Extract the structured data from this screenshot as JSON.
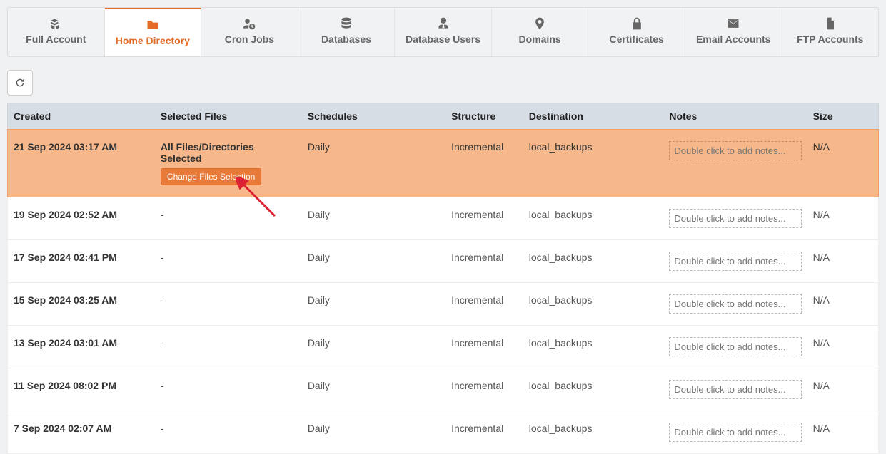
{
  "tabs": [
    {
      "label": "Full Account",
      "icon": "cubes"
    },
    {
      "label": "Home Directory",
      "icon": "folder",
      "active": true
    },
    {
      "label": "Cron Jobs",
      "icon": "user-clock"
    },
    {
      "label": "Databases",
      "icon": "database"
    },
    {
      "label": "Database Users",
      "icon": "user-tie"
    },
    {
      "label": "Domains",
      "icon": "map-pin"
    },
    {
      "label": "Certificates",
      "icon": "lock"
    },
    {
      "label": "Email Accounts",
      "icon": "envelope"
    },
    {
      "label": "FTP Accounts",
      "icon": "file"
    }
  ],
  "refresh_title": "Refresh",
  "columns": {
    "created": "Created",
    "files": "Selected Files",
    "schedules": "Schedules",
    "structure": "Structure",
    "dest": "Destination",
    "notes": "Notes",
    "size": "Size"
  },
  "notes_placeholder": "Double click to add notes...",
  "change_files_label": "Change Files Selection",
  "rows": [
    {
      "created": "21 Sep 2024 03:17 AM",
      "files": "All Files/Directories Selected",
      "schedules": "Daily",
      "structure": "Incremental",
      "dest": "local_backups",
      "size": "N/A",
      "highlight": true,
      "show_change": true
    },
    {
      "created": "19 Sep 2024 02:52 AM",
      "files": "-",
      "schedules": "Daily",
      "structure": "Incremental",
      "dest": "local_backups",
      "size": "N/A"
    },
    {
      "created": "17 Sep 2024 02:41 PM",
      "files": "-",
      "schedules": "Daily",
      "structure": "Incremental",
      "dest": "local_backups",
      "size": "N/A"
    },
    {
      "created": "15 Sep 2024 03:25 AM",
      "files": "-",
      "schedules": "Daily",
      "structure": "Incremental",
      "dest": "local_backups",
      "size": "N/A"
    },
    {
      "created": "13 Sep 2024 03:01 AM",
      "files": "-",
      "schedules": "Daily",
      "structure": "Incremental",
      "dest": "local_backups",
      "size": "N/A"
    },
    {
      "created": "11 Sep 2024 08:02 PM",
      "files": "-",
      "schedules": "Daily",
      "structure": "Incremental",
      "dest": "local_backups",
      "size": "N/A"
    },
    {
      "created": "7 Sep 2024 02:07 AM",
      "files": "-",
      "schedules": "Daily",
      "structure": "Incremental",
      "dest": "local_backups",
      "size": "N/A"
    }
  ]
}
